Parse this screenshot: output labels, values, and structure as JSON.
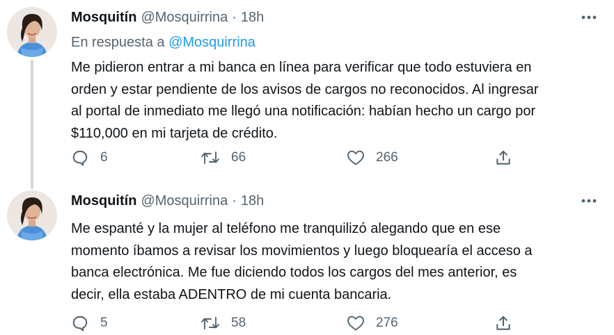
{
  "tweets": [
    {
      "display_name": "Mosquitín",
      "handle": "@Mosquirrina",
      "separator": "·",
      "time": "18h",
      "reply_prefix": "En respuesta a",
      "reply_mention": "@Mosquirrina",
      "text": "Me pidieron entrar a mi banca en línea para verificar que todo estuviera en\norden y estar pendiente de los avisos de cargos no reconocidos. Al ingresar\nal portal de inmediato me llegó una notificación: habían  hecho un cargo por\n$110,000 en mi tarjeta de crédito.",
      "replies": "6",
      "retweets": "66",
      "likes": "266"
    },
    {
      "display_name": "Mosquitín",
      "handle": "@Mosquirrina",
      "separator": "·",
      "time": "18h",
      "text": "Me espanté y la mujer al teléfono me tranquilizó alegando que en ese\nmomento íbamos a revisar los movimientos y luego bloquearía el acceso a\nbanca electrónica. Me fue diciendo todos los cargos del mes anterior, es\ndecir, ella estaba ADENTRO de mi cuenta bancaria.",
      "replies": "5",
      "retweets": "58",
      "likes": "276"
    }
  ],
  "icons": {
    "avatar": "avatar-photo",
    "more": "more-icon",
    "reply": "reply-icon",
    "retweet": "retweet-icon",
    "like": "heart-icon",
    "share": "share-icon"
  },
  "colors": {
    "text": "#0f1419",
    "secondary": "#536471",
    "link": "#1d9bf0",
    "thread_line": "#cfd9de"
  }
}
